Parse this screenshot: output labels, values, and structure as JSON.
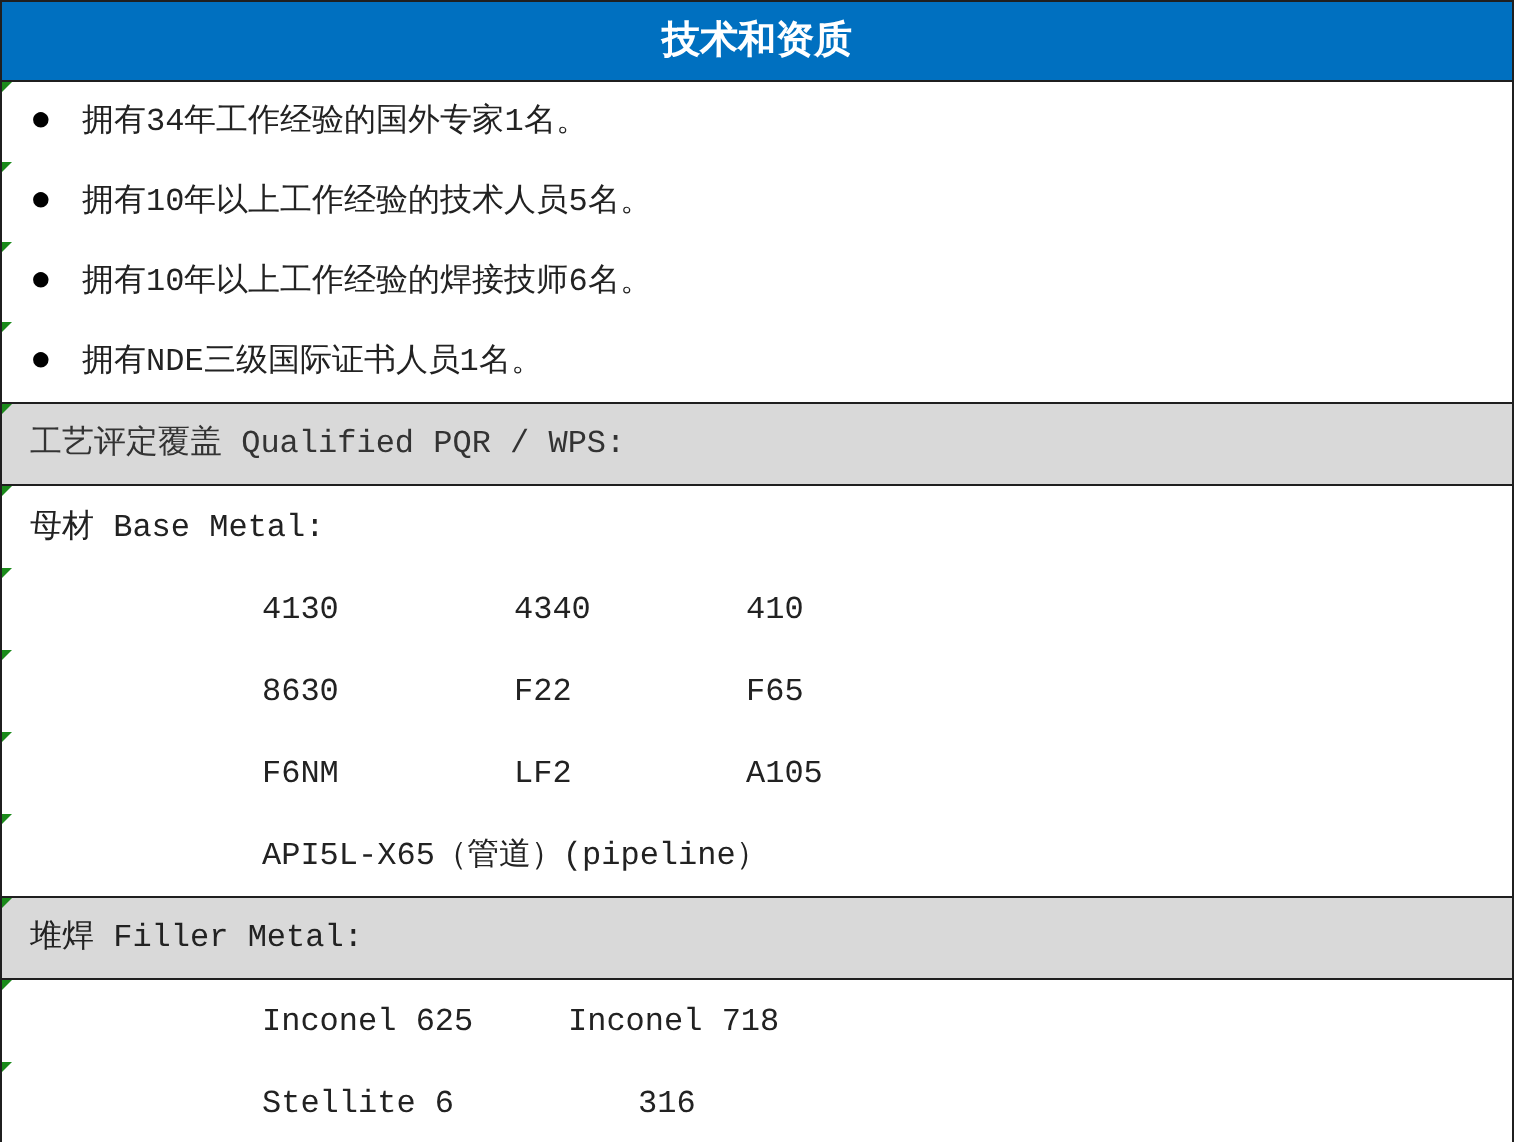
{
  "title": "技术和资质",
  "staff": [
    {
      "bullet": "●",
      "text": "拥有34年工作经验的国外专家1名。"
    },
    {
      "bullet": "●",
      "text": "拥有10年以上工作经验的技术人员5名。"
    },
    {
      "bullet": "●",
      "text": "拥有10年以上工作经验的焊接技师6名。"
    },
    {
      "bullet": "●",
      "text": "拥有NDE三级国际证书人员1名。"
    }
  ],
  "pqr_heading": "工艺评定覆盖 Qualified PQR / WPS:",
  "base_metal": {
    "label": "母材 Base Metal:",
    "rows": [
      [
        "4130",
        "4340",
        "410"
      ],
      [
        "8630",
        "F22",
        "F65"
      ],
      [
        "F6NM",
        "LF2",
        "A105"
      ],
      [
        "API5L-X65（管道）(pipeline）"
      ]
    ]
  },
  "filler_heading": "堆焊 Filler Metal:",
  "filler_metal": {
    "rows": [
      [
        "Inconel 625",
        "Inconel 718"
      ],
      [
        "Stellite 6",
        "316"
      ]
    ]
  }
}
